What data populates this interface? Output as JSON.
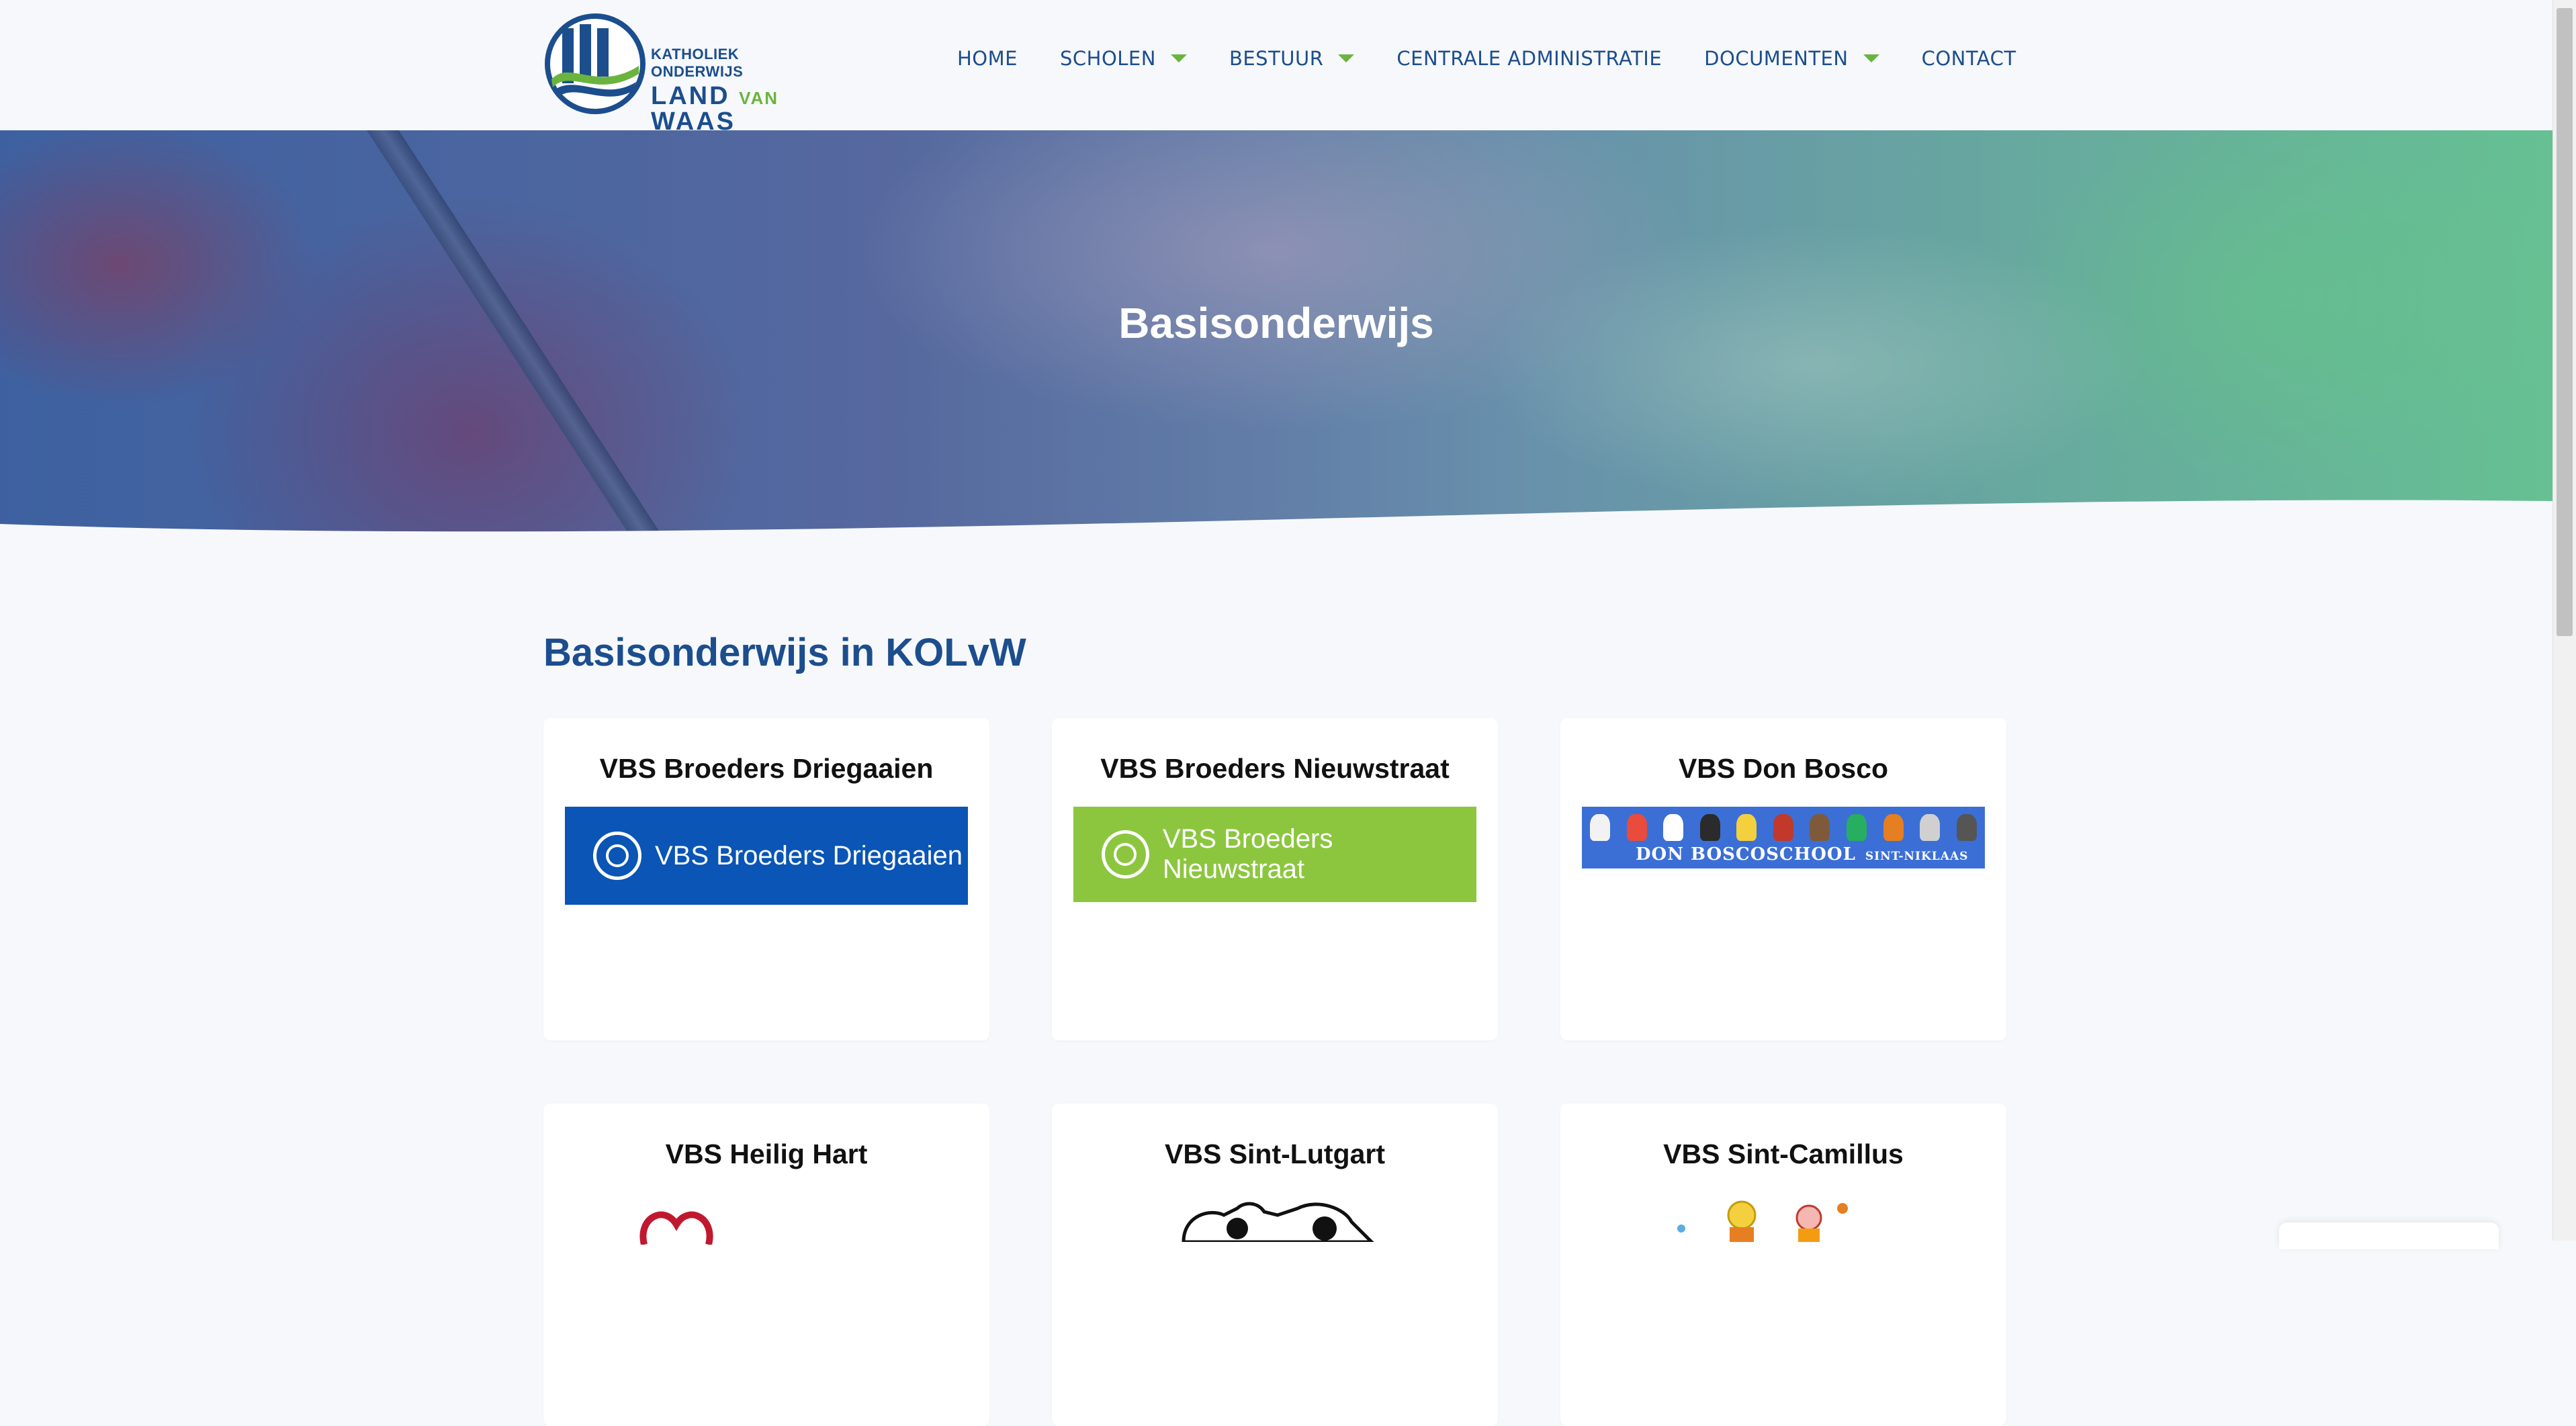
{
  "logo": {
    "line1": "KATHOLIEK ONDERWIJS",
    "line2a": "LAND",
    "line2b": "VAN",
    "line2c": "WAAS"
  },
  "nav": [
    {
      "label": "HOME",
      "has_dropdown": false
    },
    {
      "label": "SCHOLEN",
      "has_dropdown": true
    },
    {
      "label": "BESTUUR",
      "has_dropdown": true
    },
    {
      "label": "CENTRALE ADMINISTRATIE",
      "has_dropdown": false
    },
    {
      "label": "DOCUMENTEN",
      "has_dropdown": true
    },
    {
      "label": "CONTACT",
      "has_dropdown": false
    }
  ],
  "hero": {
    "title": "Basisonderwijs"
  },
  "section": {
    "title": "Basisonderwijs in KOLvW"
  },
  "schools": [
    {
      "name": "VBS Broeders Driegaaien",
      "logo_text": "VBS Broeders Driegaaien",
      "logo_color": "#0a55b5"
    },
    {
      "name": "VBS Broeders Nieuwstraat",
      "logo_text": "VBS Broeders Nieuwstraat",
      "logo_color": "#8cc63f"
    },
    {
      "name": "VBS Don Bosco",
      "logo_text": "DON BOSCOSCHOOL",
      "logo_subtext": "SINT-NIKLAAS",
      "logo_color": "#3b6fd6"
    },
    {
      "name": "VBS Heilig Hart"
    },
    {
      "name": "VBS Sint-Lutgart"
    },
    {
      "name": "VBS Sint-Camillus"
    }
  ],
  "colors": {
    "brand_blue": "#1c4e8e",
    "brand_green": "#6ab43e",
    "page_bg": "#f6f8fb"
  }
}
